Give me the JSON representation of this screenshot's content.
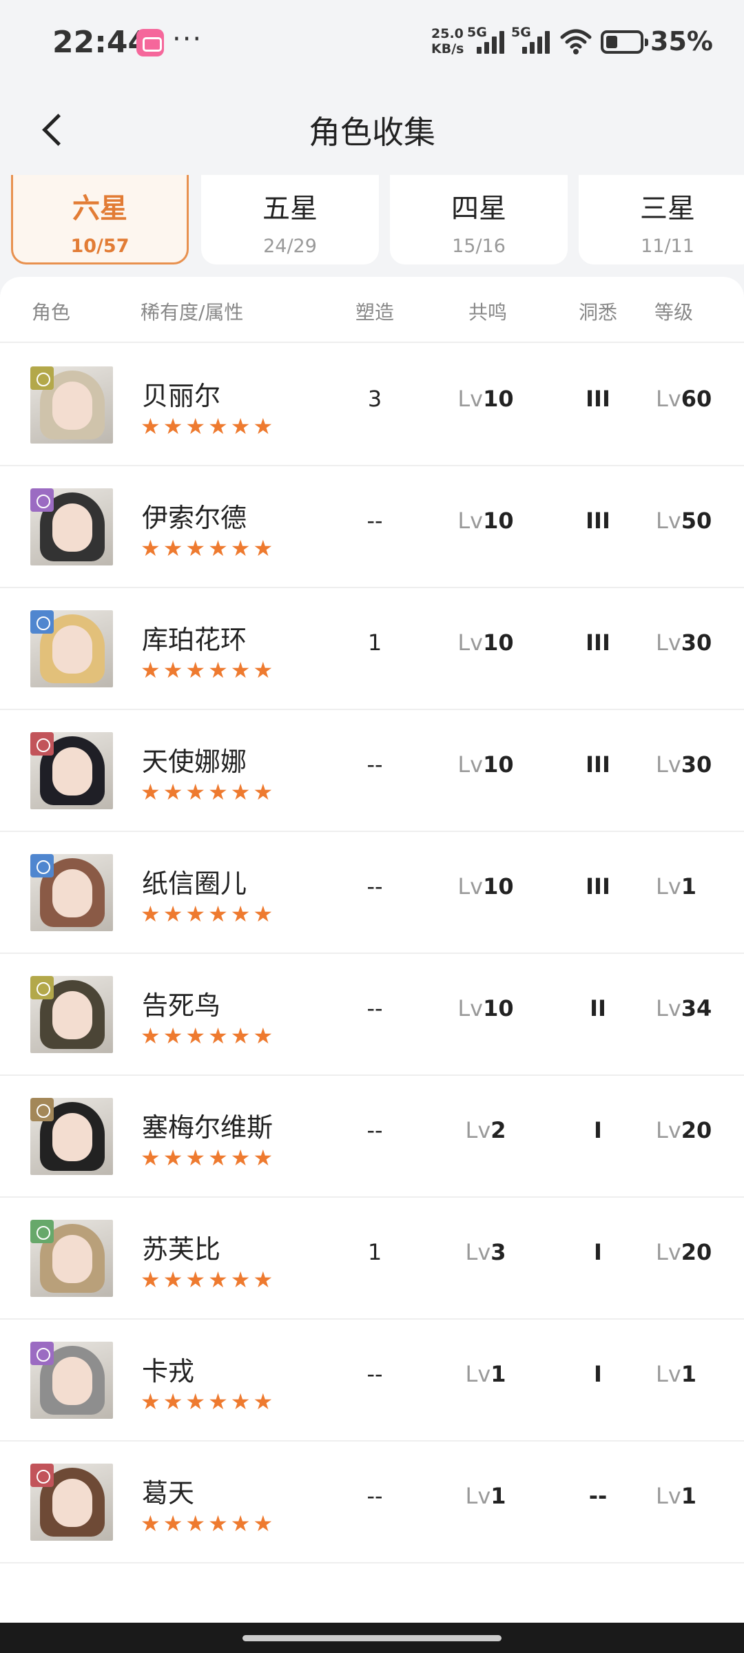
{
  "status_bar": {
    "time": "22:44",
    "dots": "···",
    "net_speed": "25.0",
    "net_unit": "KB/s",
    "sig1": "5G",
    "sig2": "5G",
    "battery": "35%",
    "battery_level": 0.35,
    "app_icon": "bilibili-icon"
  },
  "header": {
    "title": "角色收集",
    "back_icon": "back-arrow-icon"
  },
  "tabs": [
    {
      "name": "六星",
      "count": "10/57",
      "active": true
    },
    {
      "name": "五星",
      "count": "24/29",
      "active": false
    },
    {
      "name": "四星",
      "count": "15/16",
      "active": false
    },
    {
      "name": "三星",
      "count": "11/11",
      "active": false
    }
  ],
  "columns": {
    "role": "角色",
    "rarity": "稀有度/属性",
    "portray": "塑造",
    "resonance": "共鸣",
    "insight": "洞悉",
    "level": "等级"
  },
  "lv_prefix": "Lv",
  "stars_text": "★★★★★★",
  "colors": {
    "accent": "#e27c35",
    "star": "#ee7a2f",
    "attr_green_yellow": "#b3a84a",
    "attr_purple": "#9b6bc2",
    "attr_blue": "#4f86cf",
    "attr_red": "#c2545a",
    "attr_brown": "#a38758",
    "attr_green": "#67a86a"
  },
  "rows": [
    {
      "name": "贝丽尔",
      "portray": "3",
      "resonance": "10",
      "insight": "III",
      "level": "60",
      "attr": "#b3a84a",
      "hair": "#cfc3ab"
    },
    {
      "name": "伊索尔德",
      "portray": "--",
      "resonance": "10",
      "insight": "III",
      "level": "50",
      "attr": "#9b6bc2",
      "hair": "#333333"
    },
    {
      "name": "库珀花环",
      "portray": "1",
      "resonance": "10",
      "insight": "III",
      "level": "30",
      "attr": "#4f86cf",
      "hair": "#e2c07a"
    },
    {
      "name": "天使娜娜",
      "portray": "--",
      "resonance": "10",
      "insight": "III",
      "level": "30",
      "attr": "#c2545a",
      "hair": "#1f1f26"
    },
    {
      "name": "纸信圈儿",
      "portray": "--",
      "resonance": "10",
      "insight": "III",
      "level": "1",
      "attr": "#4f86cf",
      "hair": "#8a5a46"
    },
    {
      "name": "告死鸟",
      "portray": "--",
      "resonance": "10",
      "insight": "II",
      "level": "34",
      "attr": "#b3a84a",
      "hair": "#4b4536"
    },
    {
      "name": "塞梅尔维斯",
      "portray": "--",
      "resonance": "2",
      "insight": "I",
      "level": "20",
      "attr": "#a38758",
      "hair": "#222222"
    },
    {
      "name": "苏芙比",
      "portray": "1",
      "resonance": "3",
      "insight": "I",
      "level": "20",
      "attr": "#67a86a",
      "hair": "#b9a07a"
    },
    {
      "name": "卡戎",
      "portray": "--",
      "resonance": "1",
      "insight": "I",
      "level": "1",
      "attr": "#9b6bc2",
      "hair": "#8e8e8e"
    },
    {
      "name": "葛天",
      "portray": "--",
      "resonance": "1",
      "insight": "--",
      "level": "1",
      "attr": "#c2545a",
      "hair": "#6e4a36"
    }
  ]
}
